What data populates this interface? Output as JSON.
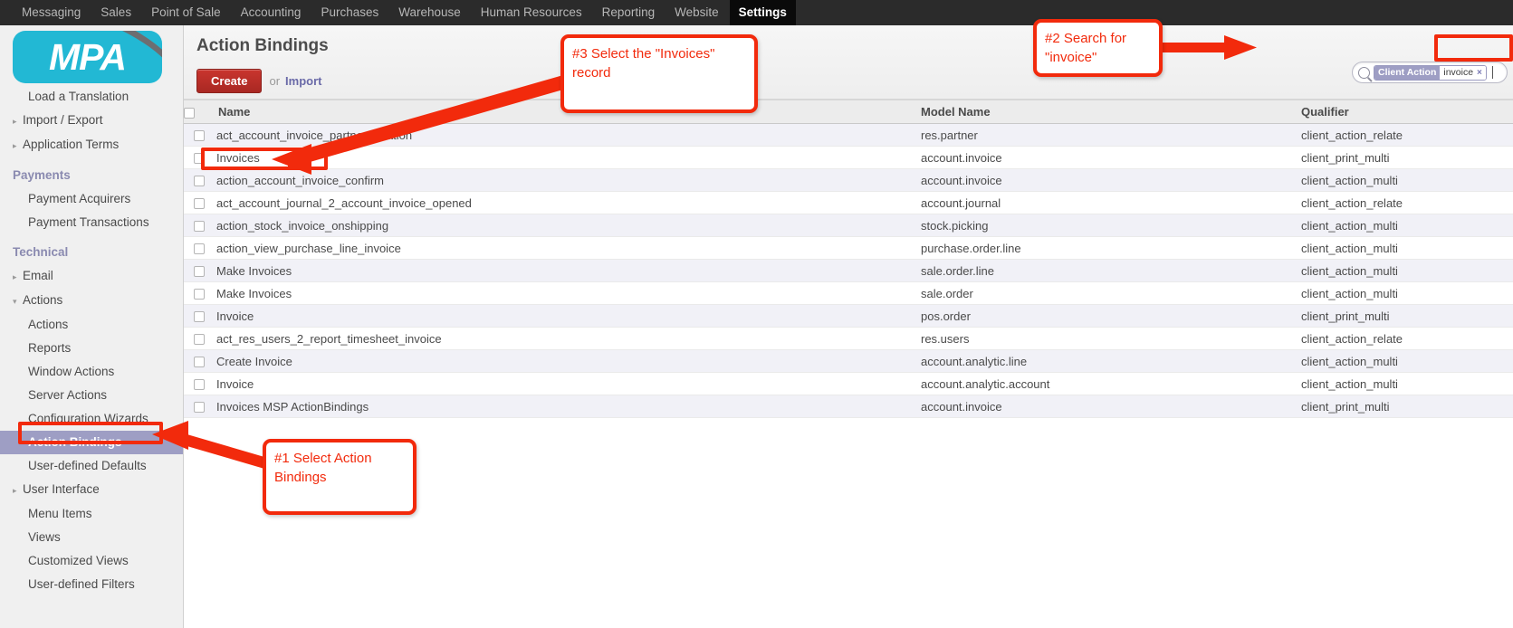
{
  "topnav": {
    "items": [
      {
        "label": "Messaging",
        "active": false
      },
      {
        "label": "Sales",
        "active": false
      },
      {
        "label": "Point of Sale",
        "active": false
      },
      {
        "label": "Accounting",
        "active": false
      },
      {
        "label": "Purchases",
        "active": false
      },
      {
        "label": "Warehouse",
        "active": false
      },
      {
        "label": "Human Resources",
        "active": false
      },
      {
        "label": "Reporting",
        "active": false
      },
      {
        "label": "Website",
        "active": false
      },
      {
        "label": "Settings",
        "active": true
      }
    ]
  },
  "logo": {
    "text": "MPA",
    "bg_color": "#22b8d4",
    "swoosh_color": "#6d6e71"
  },
  "sidebar": {
    "items": [
      {
        "label": "Load a Translation",
        "level": 2,
        "caret": "none",
        "selected": false,
        "section": false
      },
      {
        "label": "Import / Export",
        "level": 1,
        "caret": "closed",
        "selected": false,
        "section": false
      },
      {
        "label": "Application Terms",
        "level": 1,
        "caret": "closed",
        "selected": false,
        "section": false
      },
      {
        "label": "Payments",
        "level": 1,
        "caret": "none",
        "selected": false,
        "section": true
      },
      {
        "label": "Payment Acquirers",
        "level": 2,
        "caret": "none",
        "selected": false,
        "section": false
      },
      {
        "label": "Payment Transactions",
        "level": 2,
        "caret": "none",
        "selected": false,
        "section": false
      },
      {
        "label": "Technical",
        "level": 1,
        "caret": "none",
        "selected": false,
        "section": true
      },
      {
        "label": "Email",
        "level": 1,
        "caret": "closed",
        "selected": false,
        "section": false
      },
      {
        "label": "Actions",
        "level": 1,
        "caret": "open",
        "selected": false,
        "section": false
      },
      {
        "label": "Actions",
        "level": 2,
        "caret": "none",
        "selected": false,
        "section": false
      },
      {
        "label": "Reports",
        "level": 2,
        "caret": "none",
        "selected": false,
        "section": false
      },
      {
        "label": "Window Actions",
        "level": 2,
        "caret": "none",
        "selected": false,
        "section": false
      },
      {
        "label": "Server Actions",
        "level": 2,
        "caret": "none",
        "selected": false,
        "section": false
      },
      {
        "label": "Configuration Wizards",
        "level": 2,
        "caret": "none",
        "selected": false,
        "section": false
      },
      {
        "label": "Action Bindings",
        "level": 2,
        "caret": "none",
        "selected": true,
        "section": false
      },
      {
        "label": "User-defined Defaults",
        "level": 2,
        "caret": "none",
        "selected": false,
        "section": false
      },
      {
        "label": "User Interface",
        "level": 1,
        "caret": "closed",
        "selected": false,
        "section": false
      },
      {
        "label": "Menu Items",
        "level": 2,
        "caret": "none",
        "selected": false,
        "section": false
      },
      {
        "label": "Views",
        "level": 2,
        "caret": "none",
        "selected": false,
        "section": false
      },
      {
        "label": "Customized Views",
        "level": 2,
        "caret": "none",
        "selected": false,
        "section": false
      },
      {
        "label": "User-defined Filters",
        "level": 2,
        "caret": "none",
        "selected": false,
        "section": false
      }
    ]
  },
  "page": {
    "title": "Action Bindings",
    "create_label": "Create",
    "or_label": "or",
    "import_label": "Import"
  },
  "search": {
    "facet_category": "Client Action",
    "facet_value": "invoice",
    "facet_remove": "×"
  },
  "table": {
    "columns": [
      "Name",
      "Model Name",
      "Qualifier"
    ],
    "rows": [
      {
        "name": "act_account_invoice_partner_relation",
        "model": "res.partner",
        "qualifier": "client_action_relate"
      },
      {
        "name": "Invoices",
        "model": "account.invoice",
        "qualifier": "client_print_multi"
      },
      {
        "name": "action_account_invoice_confirm",
        "model": "account.invoice",
        "qualifier": "client_action_multi"
      },
      {
        "name": "act_account_journal_2_account_invoice_opened",
        "model": "account.journal",
        "qualifier": "client_action_relate"
      },
      {
        "name": "action_stock_invoice_onshipping",
        "model": "stock.picking",
        "qualifier": "client_action_multi"
      },
      {
        "name": "action_view_purchase_line_invoice",
        "model": "purchase.order.line",
        "qualifier": "client_action_multi"
      },
      {
        "name": "Make Invoices",
        "model": "sale.order.line",
        "qualifier": "client_action_multi"
      },
      {
        "name": "Make Invoices",
        "model": "sale.order",
        "qualifier": "client_action_multi"
      },
      {
        "name": "Invoice",
        "model": "pos.order",
        "qualifier": "client_print_multi"
      },
      {
        "name": "act_res_users_2_report_timesheet_invoice",
        "model": "res.users",
        "qualifier": "client_action_relate"
      },
      {
        "name": "Create Invoice",
        "model": "account.analytic.line",
        "qualifier": "client_action_multi"
      },
      {
        "name": "Invoice",
        "model": "account.analytic.account",
        "qualifier": "client_action_multi"
      },
      {
        "name": "Invoices MSP ActionBindings",
        "model": "account.invoice",
        "qualifier": "client_print_multi"
      }
    ]
  },
  "annotations": {
    "step1": "#1 Select Action Bindings",
    "step2": "#2 Search for \"invoice\"",
    "step3": "#3 Select the \"Invoices\" record",
    "color": "#f22a0c"
  }
}
